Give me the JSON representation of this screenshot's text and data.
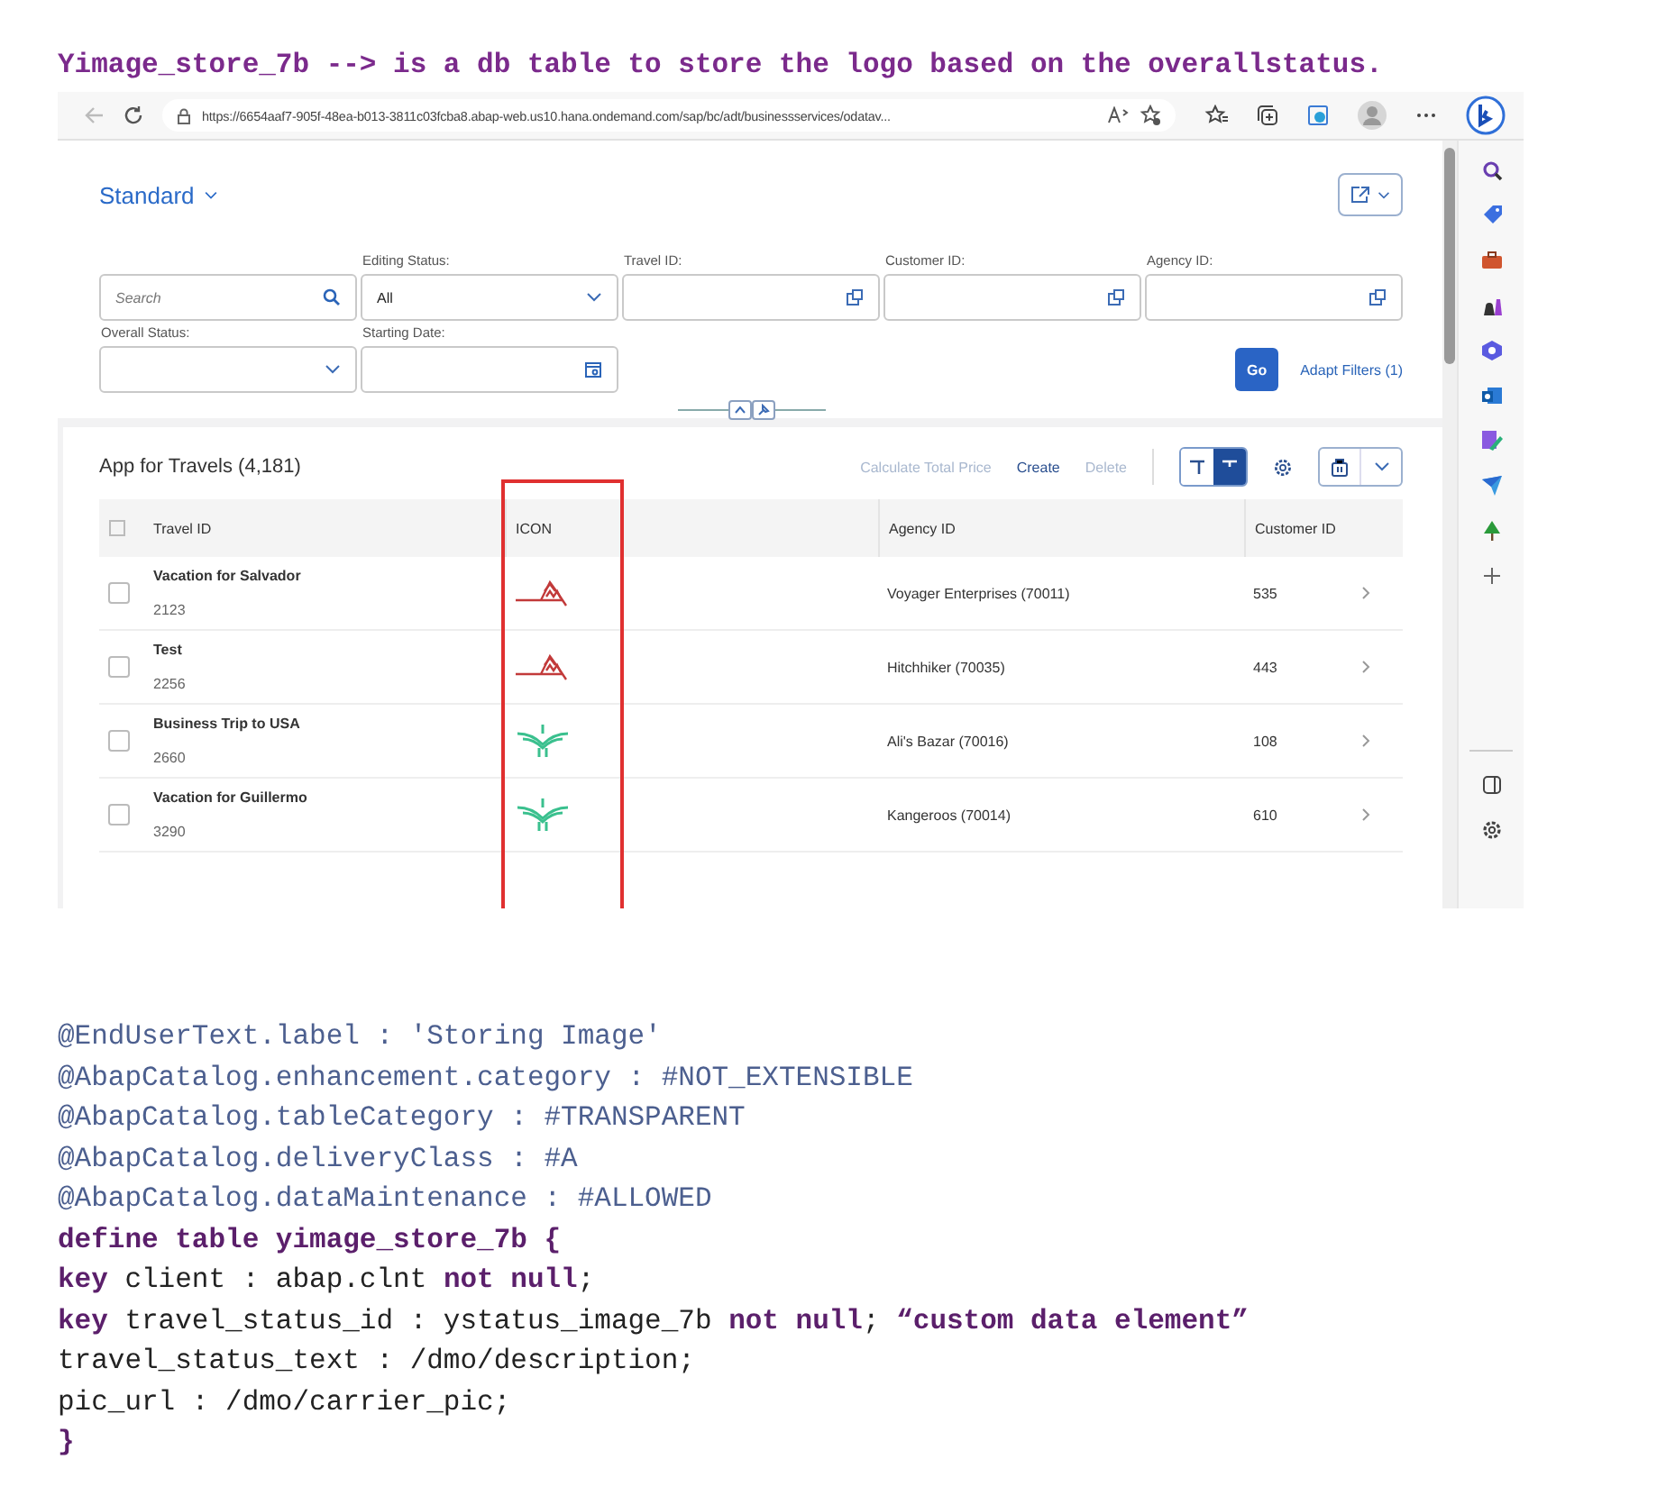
{
  "heading": "Yimage_store_7b --> is a db table to store the logo based on the overallstatus.",
  "browser": {
    "url": "https://6654aaf7-905f-48ea-b013-3811c03fcba8.abap-web.us10.hana.ondemand.com/sap/bc/adt/businessservices/odatav..."
  },
  "app": {
    "variant": "Standard",
    "filters": [
      {
        "kind": "search",
        "placeholder": "Search"
      },
      {
        "kind": "select",
        "label": "Editing Status:",
        "value": "All"
      },
      {
        "kind": "valuehelp",
        "label": "Travel ID:"
      },
      {
        "kind": "valuehelp",
        "label": "Customer ID:"
      },
      {
        "kind": "valuehelp",
        "label": "Agency ID:"
      },
      {
        "kind": "select",
        "label": "Overall Status:"
      },
      {
        "kind": "date",
        "label": "Starting Date:"
      }
    ],
    "go": "Go",
    "adapt_filters": "Adapt Filters (1)",
    "table_title": "App for Travels (4,181)",
    "actions": [
      {
        "label": "Calculate Total Price",
        "disabled": true
      },
      {
        "label": "Create",
        "disabled": false
      },
      {
        "label": "Delete",
        "disabled": true
      }
    ],
    "view_toggle": [
      {
        "selected": false
      },
      {
        "selected": true
      }
    ],
    "columns": [
      "Travel ID",
      "ICON",
      "Agency ID",
      "Customer ID"
    ],
    "rows": [
      {
        "checked": false,
        "title": "Vacation for Salvador",
        "id": "2123",
        "kind": "peaks",
        "agency": "Voyager Enterprises (70011)",
        "customer": "535"
      },
      {
        "checked": false,
        "title": "Test",
        "id": "2256",
        "kind": "peaks",
        "agency": "Hitchhiker (70035)",
        "customer": "443"
      },
      {
        "checked": false,
        "title": "Business Trip to USA",
        "id": "2660",
        "kind": "wings",
        "agency": "Ali's Bazar (70016)",
        "customer": "108"
      },
      {
        "checked": false,
        "title": "Vacation for Guillermo",
        "id": "3290",
        "kind": "wings",
        "agency": "Kangeroos (70014)",
        "customer": "610"
      }
    ]
  },
  "code": [
    {
      "kind": "annotation",
      "text": "@EndUserText.label : 'Storing Image'"
    },
    {
      "kind": "annotation",
      "text": "@AbapCatalog.enhancement.category : #NOT_EXTENSIBLE"
    },
    {
      "kind": "annotation",
      "text": "@AbapCatalog.tableCategory : #TRANSPARENT"
    },
    {
      "kind": "annotation",
      "text": "@AbapCatalog.deliveryClass : #A"
    },
    {
      "kind": "annotation",
      "text": "@AbapCatalog.dataMaintenance : #ALLOWED"
    },
    {
      "kind": "statement",
      "text": "define table yimage_store_7b {"
    },
    {
      "kind": "code",
      "text": "**key** client : abap.clnt **not null**;"
    },
    {
      "kind": "code",
      "text": "**key** travel_status_id : ystatus_image_7b **not null**; **“custom data element”**"
    },
    {
      "kind": "code",
      "text": "travel_status_text : /dmo/description;"
    },
    {
      "kind": "code",
      "text": "pic_url : /dmo/carrier_pic;"
    },
    {
      "kind": "statement",
      "text": "}"
    }
  ]
}
